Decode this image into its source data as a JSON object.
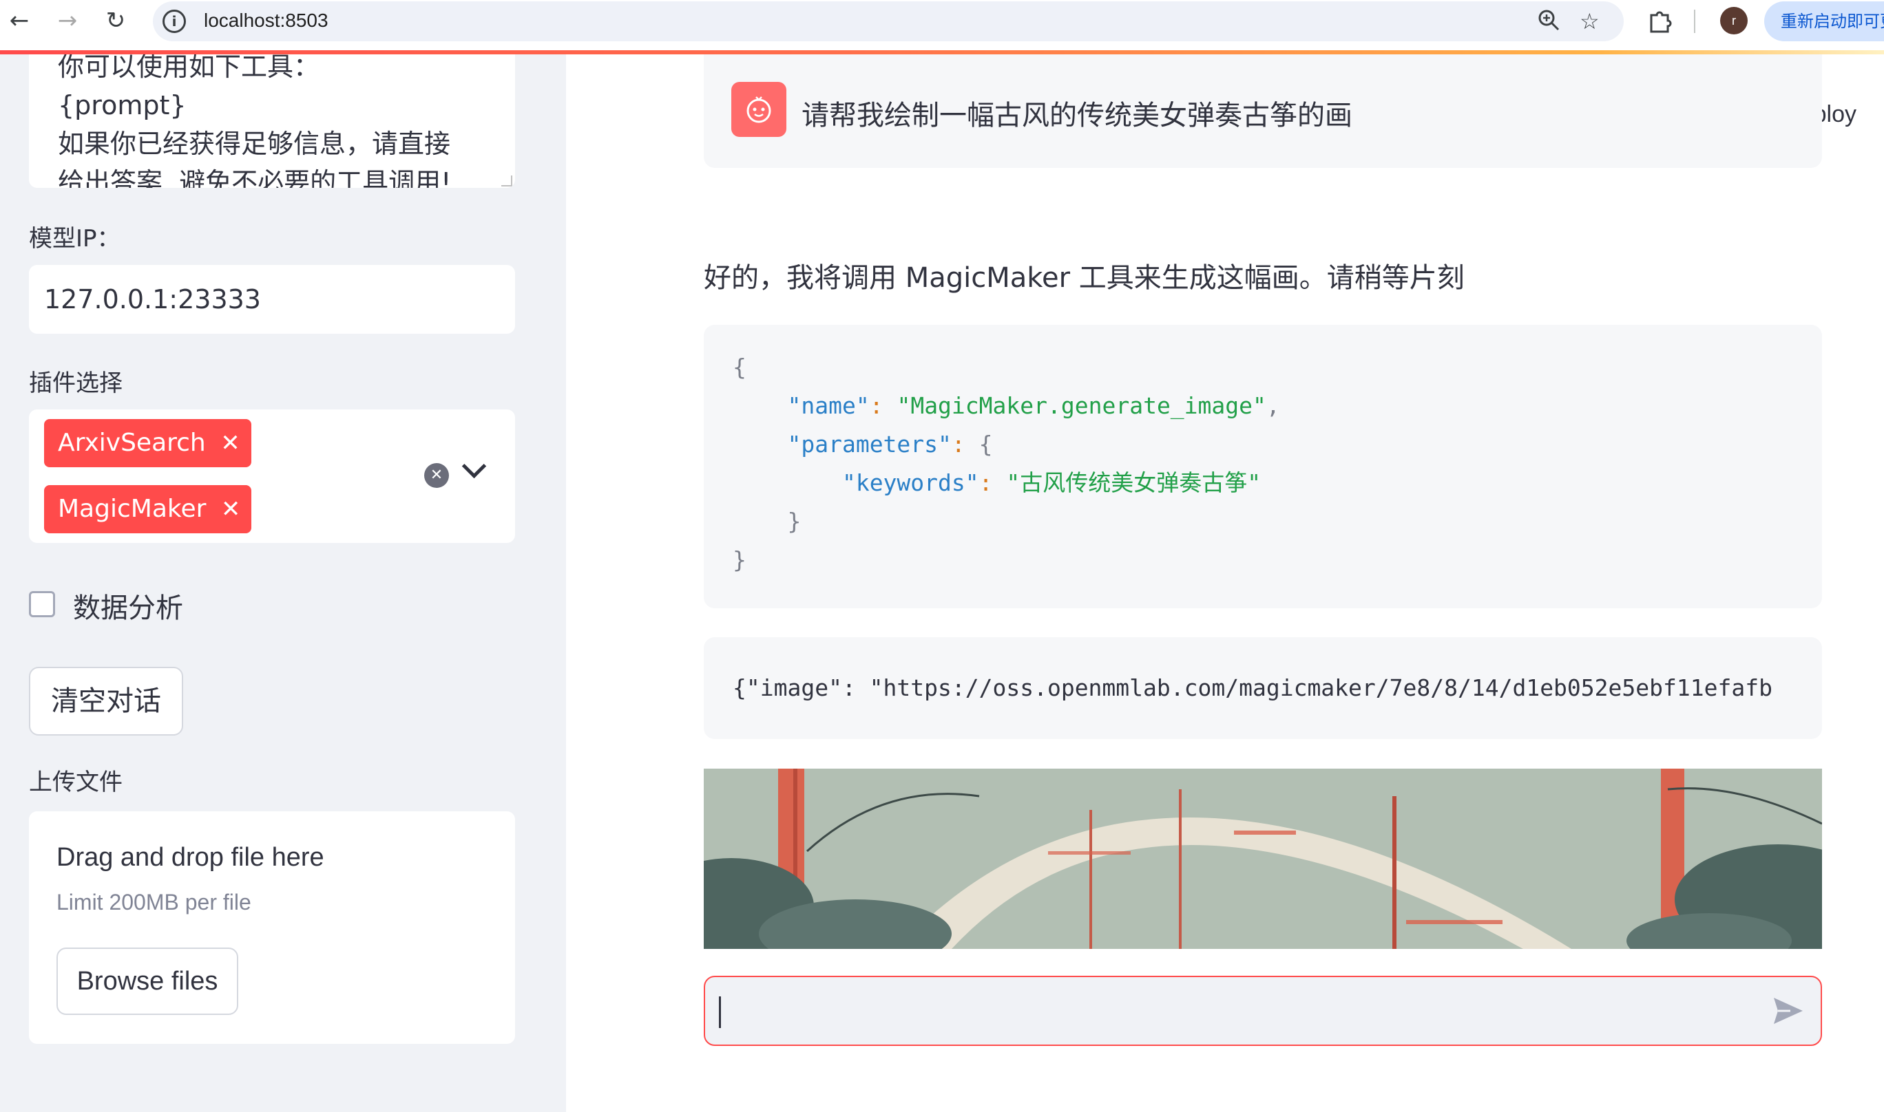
{
  "browser": {
    "url": "localhost:8503",
    "relaunch_label": "重新启动即可更新",
    "avatar_letter": "r",
    "icons": [
      "back-icon",
      "forward-icon",
      "reload-icon",
      "site-info-icon",
      "zoom-icon",
      "bookmark-star-icon",
      "extensions-icon"
    ]
  },
  "sidebar": {
    "prompt_text": "你可以使用如下工具：\n{prompt}\n如果你已经获得足够信息，请直接\n给出答案. 避免不必要的工具调用!",
    "model_ip_label": "模型IP：",
    "model_ip_value": "127.0.0.1:23333",
    "plugin_label": "插件选择",
    "plugins": [
      "ArxivSearch",
      "MagicMaker"
    ],
    "data_analysis_label": "数据分析",
    "clear_button": "清空对话",
    "upload_label": "上传文件",
    "uploader": {
      "title": "Drag and drop file here",
      "limit": "Limit 200MB per file",
      "browse": "Browse files"
    }
  },
  "main": {
    "deploy": "Deploy",
    "user_message": "请帮我绘制一幅古风的传统美女弹奏古筝的画",
    "assistant_message": "好的，我将调用 MagicMaker 工具来生成这幅画。请稍等片刻",
    "code": {
      "open_brace": "{",
      "name_key": "\"name\"",
      "name_value": "\"MagicMaker.generate_image\"",
      "params_key": "\"parameters\"",
      "keywords_key": "\"keywords\"",
      "keywords_value": "\"古风传统美女弹奏古筝\"",
      "inner_close": "}",
      "close_brace": "}"
    },
    "result_text": "{\"image\": \"https://oss.openmmlab.com/magicmaker/7e8/8/14/d1eb052e5ebf11efafb",
    "colors": {
      "accent": "#ff4b4b",
      "sidebar_bg": "#f0f2f6",
      "code_bg": "#f6f7f9"
    }
  }
}
